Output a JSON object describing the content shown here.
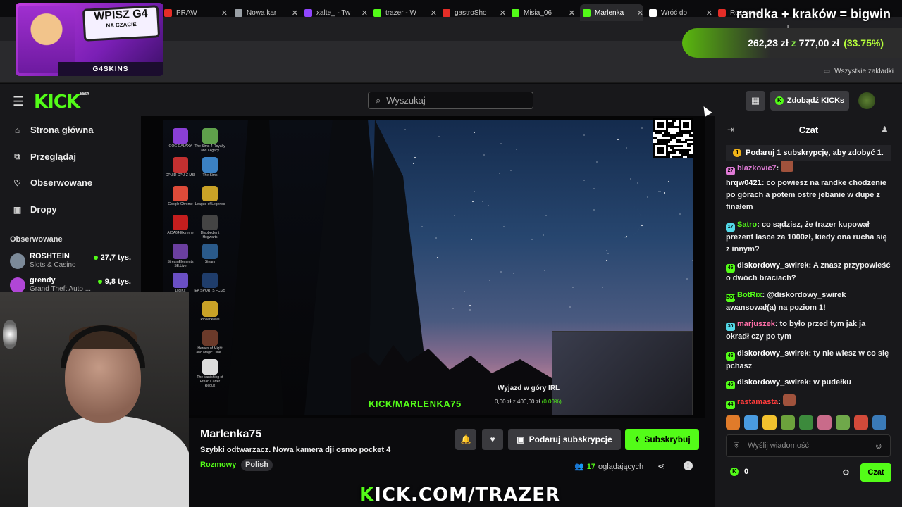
{
  "browser": {
    "tabs": [
      {
        "label": "PRAW",
        "favicon_color": "#e52d27",
        "icon": "youtube-icon"
      },
      {
        "label": "Nowa kar",
        "favicon_color": "#9aa0a6",
        "icon": "globe-icon"
      },
      {
        "label": "xalte_ - Tw",
        "favicon_color": "#9146ff",
        "icon": "twitch-icon"
      },
      {
        "label": "trazer - W",
        "favicon_color": "#53fc18",
        "icon": "kick-icon"
      },
      {
        "label": "gastroSho",
        "favicon_color": "#e52d27",
        "icon": "youtube-icon"
      },
      {
        "label": "Misia_06",
        "favicon_color": "#53fc18",
        "icon": "kick-icon"
      },
      {
        "label": "Marlenka",
        "favicon_color": "#53fc18",
        "icon": "kick-icon",
        "active": true
      },
      {
        "label": "Wróć do",
        "favicon_color": "#ffffff",
        "icon": "bing-icon"
      },
      {
        "label": "Rozmowa",
        "favicon_color": "#e52d27",
        "icon": "youtube-icon"
      }
    ],
    "new_tab": "+",
    "bookmarks_other": "Wszystkie zakładki"
  },
  "overlay": {
    "promo_badge": "WPISZ G4",
    "promo_sub": "NA CZACIE",
    "promo_brand": "G4SKINS",
    "top_text": "randka + kraków = bigwin",
    "money_amount": "262,23 zł",
    "money_of": "z",
    "money_target": "777,00 zł",
    "money_pct": "(33.75%)",
    "bottom_url_k": "K",
    "bottom_url_rest": "ICK.COM/TRAZER"
  },
  "header": {
    "logo": "KICK",
    "logo_tag": "BETA",
    "search_placeholder": "Wyszukaj",
    "kicks_button": "Zdobądź KICKs"
  },
  "sidebar": {
    "nav": [
      {
        "label": "Strona główna",
        "icon": "home-icon"
      },
      {
        "label": "Przeglądaj",
        "icon": "browse-icon"
      },
      {
        "label": "Obserwowane",
        "icon": "heart-icon"
      },
      {
        "label": "Dropy",
        "icon": "gift-icon"
      }
    ],
    "following_header": "Obserwowane",
    "following": [
      {
        "name": "ROSHTEIN",
        "category": "Slots & Casino",
        "viewers": "27,7 tys."
      },
      {
        "name": "grendy",
        "category": "Grand Theft Auto ...",
        "viewers": "9,8 tys."
      }
    ]
  },
  "video": {
    "desktop_icons": [
      "GOG GALAXY",
      "The Sims 4 Royalty and Legacy",
      "CPUID CPU-Z MSI",
      "The Sims",
      "Google Chrome",
      "League of Legends",
      "AIDA64 Extreme",
      "Disobedient Hogwarts",
      "StreamElements SE.Live",
      "Steam",
      "DigiKit",
      "EA SPORTS FC 25",
      "",
      "Piosenkowe",
      "",
      "Heroes of Might and Magic Olde...",
      "",
      "The Vanishing of Ethan Carter Redux"
    ],
    "irl_text": "Wyjazd w góry IRL",
    "irl_progress": "0,00 zł z 400,00 zł",
    "irl_pct": "(0.00%)",
    "vid_url": "KICK/MARLENKA75"
  },
  "stream": {
    "streamer": "Marlenka75",
    "title": "Szybki odtwarzacz. Nowa kamera dji osmo pocket 4",
    "category": "Rozmowy",
    "language": "Polish",
    "gift_button": "Podaruj subskrypcje",
    "subscribe_button": "Subskrybuj",
    "viewers_count": "17",
    "viewers_label": "oglądających"
  },
  "chat": {
    "title": "Czat",
    "pinned": "Podaruj 1 subskrypcję, aby zdobyć 1.",
    "messages": [
      {
        "badge": "27",
        "badge_color": "#e07bd6",
        "user": "blazkovic7",
        "user_color": "#e07bd6",
        "text": ""
      },
      {
        "badge": "",
        "badge_color": "",
        "user": "hrqw0421",
        "user_color": "#ffffff",
        "text": "co powiesz na randke chodzenie po górach a potem ostre jebanie w dupe z finałem"
      },
      {
        "badge": "17",
        "badge_color": "#53d9e8",
        "user": "Satro",
        "user_color": "#53fc18",
        "text": "co sądzisz, że trazer kupował prezent lasce za 1000zł, kiedy ona rucha się z innym?"
      },
      {
        "badge": "46",
        "badge_color": "#53fc18",
        "user": "diskordowy_swirek",
        "user_color": "#ffffff",
        "text": "A znasz przypowieść o dwóch braciach?"
      },
      {
        "badge": "BOT",
        "badge_color": "#53fc18",
        "user": "BotRix",
        "user_color": "#53fc18",
        "text": "@diskordowy_swirek awansował(a) na poziom 1!"
      },
      {
        "badge": "30",
        "badge_color": "#53d9e8",
        "user": "marjuszek",
        "user_color": "#ff6fa8",
        "text": "to było przed tym jak ja okradł czy po tym"
      },
      {
        "badge": "46",
        "badge_color": "#53fc18",
        "user": "diskordowy_swirek",
        "user_color": "#ffffff",
        "text": "ty nie wiesz w co się pchasz"
      },
      {
        "badge": "46",
        "badge_color": "#53fc18",
        "user": "diskordowy_swirek",
        "user_color": "#ffffff",
        "text": "w pudełku"
      },
      {
        "badge": "44",
        "badge_color": "#53fc18",
        "user": "rastamasta",
        "user_color": "#ff3b3b",
        "text": ""
      }
    ],
    "input_placeholder": "Wyślij wiadomość",
    "kicks_count": "0",
    "send_button": "Czat"
  },
  "colors": {
    "kick_green": "#53fc18",
    "bg": "#0b0b0d",
    "panel": "#18181b"
  }
}
